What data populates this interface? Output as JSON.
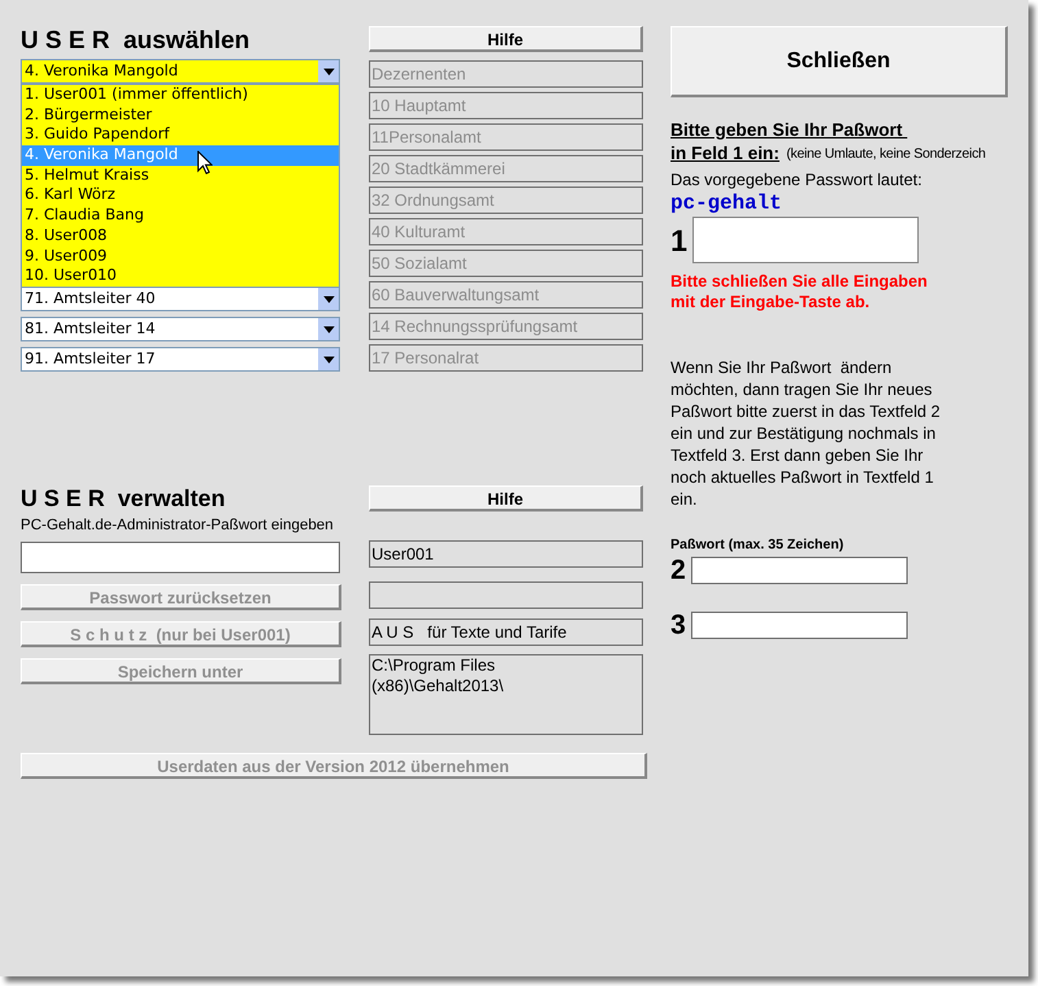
{
  "select_user": {
    "title": "U S E R  auswählen",
    "combo": {
      "value": "4. Veronika Mangold"
    },
    "dropdown": [
      {
        "label": "1. User001 (immer öffentlich)",
        "selected": false
      },
      {
        "label": "2. Bürgermeister",
        "selected": false
      },
      {
        "label": "3. Guido Papendorf",
        "selected": false
      },
      {
        "label": "4. Veronika Mangold",
        "selected": true
      },
      {
        "label": "5. Helmut Kraiss",
        "selected": false
      },
      {
        "label": "6. Karl Wörz",
        "selected": false
      },
      {
        "label": "7. Claudia Bang",
        "selected": false
      },
      {
        "label": "8. User008",
        "selected": false
      },
      {
        "label": "9. User009",
        "selected": false
      },
      {
        "label": "10. User010",
        "selected": false
      }
    ],
    "combos": [
      "71. Amtsleiter 40",
      "81. Amtsleiter 14",
      "91. Amtsleiter 17"
    ]
  },
  "departments": {
    "help_button": "Hilfe",
    "fields": [
      {
        "value": "Dezernenten",
        "disabled": true
      },
      {
        "value": "10 Hauptamt",
        "disabled": true
      },
      {
        "value": "11Personalamt",
        "disabled": true
      },
      {
        "value": "20 Stadtkämmerei",
        "disabled": true
      },
      {
        "value": "32 Ordnungsamt",
        "disabled": true
      },
      {
        "value": "40 Kulturamt",
        "disabled": true
      },
      {
        "value": "50 Sozialamt",
        "disabled": true
      },
      {
        "value": "60 Bauverwaltungsamt",
        "disabled": true
      },
      {
        "value": "14 Rechnungssprüfungsamt",
        "disabled": true
      },
      {
        "value": "17 Personalrat",
        "disabled": true
      }
    ]
  },
  "manage_user": {
    "title": "U S E R  verwalten",
    "hint": "PC-Gehalt.de-Administrator-Paßwort eingeben",
    "help_button": "Hilfe",
    "buttons": [
      {
        "label": "Passwort zurücksetzen",
        "disabled": true
      },
      {
        "label": "S c h u t z  (nur bei User001)",
        "disabled": true
      },
      {
        "label": "Speichern unter",
        "disabled": true
      }
    ],
    "user_field": "User001",
    "protection_field": "A U S   für Texte und Tarife",
    "path_field": "C:\\Program Files (x86)\\Gehalt2013\\"
  },
  "import_button": {
    "label": "Userdaten aus der Version 2012 übernehmen",
    "disabled": true
  },
  "password": {
    "close_button": "Schließen",
    "heading_line1": "Bitte geben Sie Ihr Paßwort ",
    "heading_line2": "in Feld 1 ein:",
    "note": "(keine Umlaute, keine Sonderzeich",
    "default_label": "Das vorgegebene Passwort lautet:",
    "default_password": "pc-gehalt",
    "field_1_label": "1",
    "warning": "Bitte schließen Sie alle Eingaben mit der Eingabe-Taste ab.",
    "info": "Wenn Sie Ihr Paßwort  ändern möchten, dann tragen Sie Ihr neues Paßwort bitte zuerst in das Textfeld 2 ein und zur Bestätigung nochmals in Textfeld 3. Erst dann geben Sie Ihr noch aktuelles Paßwort in Textfeld 1 ein.",
    "new_label": "Paßwort (max. 35 Zeichen)",
    "field_2_label": "2",
    "field_3_label": "3"
  }
}
